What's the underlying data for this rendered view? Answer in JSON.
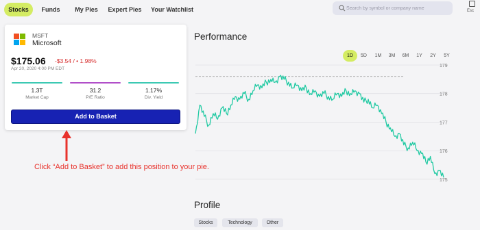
{
  "nav": {
    "tabs": [
      {
        "label": "Stocks",
        "active": true
      },
      {
        "label": "Funds",
        "active": false
      },
      {
        "label": "My Pies",
        "active": false
      },
      {
        "label": "Expert Pies",
        "active": false
      },
      {
        "label": "Your Watchlist",
        "active": false
      }
    ],
    "search_placeholder": "Search by symbol or company name",
    "esc_label": "Esc"
  },
  "stock": {
    "ticker": "MSFT",
    "name": "Microsoft",
    "price": "$175.06",
    "change": "-$3.54 / • 1.98%",
    "date": "Apr 20, 2020 4:00 PM EDT",
    "stats": [
      {
        "value": "1.3T",
        "label": "Market Cap",
        "color": "#3cc9b3"
      },
      {
        "value": "31.2",
        "label": "P/E Ratio",
        "color": "#b14fc9"
      },
      {
        "value": "1.17%",
        "label": "Div. Yield",
        "color": "#3cc9b3"
      }
    ],
    "add_button_label": "Add to Basket"
  },
  "annotation": "Click “Add to Basket” to add this position to your pie.",
  "performance": {
    "title": "Performance",
    "ranges": [
      {
        "label": "1D",
        "active": true
      },
      {
        "label": "5D",
        "active": false
      },
      {
        "label": "1M",
        "active": false
      },
      {
        "label": "3M",
        "active": false
      },
      {
        "label": "6M",
        "active": false
      },
      {
        "label": "1Y",
        "active": false
      },
      {
        "label": "2Y",
        "active": false
      },
      {
        "label": "5Y",
        "active": false
      }
    ]
  },
  "chart_data": {
    "type": "line",
    "title": "",
    "xlabel": "",
    "ylabel": "",
    "y_ticks": [
      "179",
      "178",
      "177",
      "176",
      "175"
    ],
    "ylim": [
      174.9,
      179.0
    ],
    "previous_close": 178.6,
    "line_color": "#1fc9a2",
    "series": [
      {
        "values": [
          176.6,
          177.6,
          177.2,
          176.9,
          177.3,
          177.1,
          177.5,
          177.3,
          177.6,
          177.9,
          177.8,
          178.0,
          177.8,
          178.1,
          178.3,
          178.2,
          178.4,
          178.5,
          178.4,
          178.6,
          178.5,
          178.4,
          178.2,
          178.3,
          178.1,
          178.2,
          178.0,
          178.1,
          177.9,
          178.0,
          177.9,
          177.8,
          178.0,
          177.9,
          178.1,
          178.0,
          178.1,
          178.0,
          177.7,
          177.8,
          177.5,
          177.6,
          177.3,
          177.0,
          176.8,
          176.5,
          176.6,
          176.2,
          176.1,
          176.3,
          176.0,
          175.9,
          175.6,
          175.8,
          175.2,
          175.3,
          175.06
        ]
      }
    ]
  },
  "profile": {
    "title": "Profile",
    "tags": [
      "Stocks",
      "Technology",
      "Other"
    ]
  },
  "colors": {
    "accent": "#d4ec63",
    "button": "#1722b3",
    "negative": "#d62c2c",
    "annotation": "#e8322c"
  }
}
